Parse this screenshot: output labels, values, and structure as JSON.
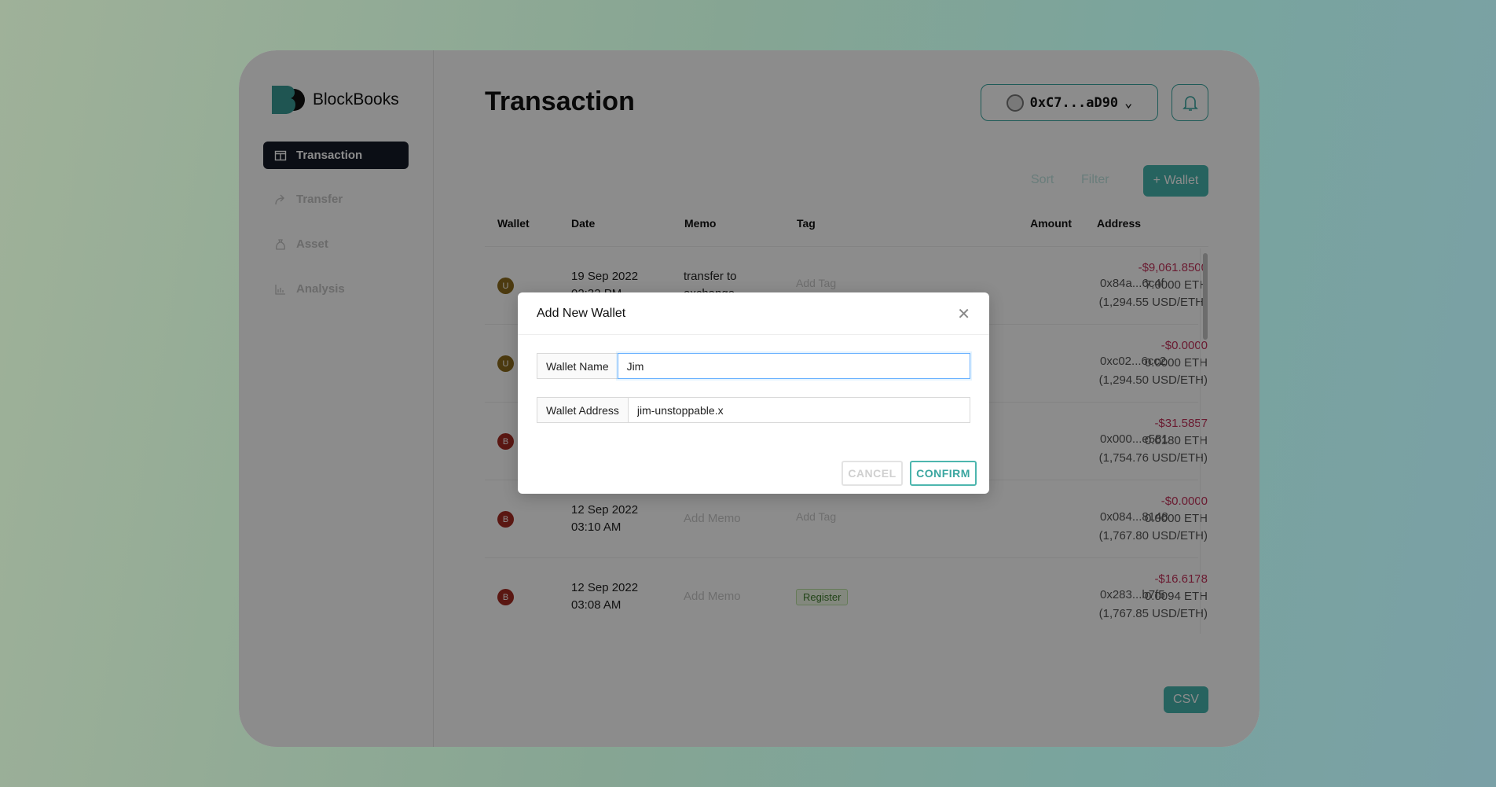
{
  "app": {
    "name": "BlockBooks",
    "accent": "#45b4ad"
  },
  "sidebar": {
    "items": [
      {
        "label": "Transaction",
        "icon": "table-icon",
        "active": true
      },
      {
        "label": "Transfer",
        "icon": "share-arrow-icon"
      },
      {
        "label": "Asset",
        "icon": "money-bag-icon"
      },
      {
        "label": "Analysis",
        "icon": "bar-chart-icon"
      }
    ]
  },
  "header": {
    "title": "Transaction",
    "wallet": "0xC7...aD90"
  },
  "toolbar": {
    "sort": "Sort",
    "filter": "Filter",
    "add_wallet": "+ Wallet",
    "csv": "CSV"
  },
  "table": {
    "columns": [
      "Wallet",
      "Date",
      "Memo",
      "Tag",
      "Amount",
      "Address"
    ],
    "rows": [
      {
        "wallet": "U",
        "color": "#8a6a1c",
        "date": "19 Sep 2022",
        "time": "02:32 PM",
        "memo": "transfer to",
        "memo2": "exchange",
        "tag": "Add Tag",
        "usd": "-$9,061.8500",
        "eth": "7.0000 ETH",
        "rate": "(1,294.55 USD/ETH)",
        "address": "0x84a...6c4f"
      },
      {
        "wallet": "U",
        "color": "#8a6a1c",
        "date": "",
        "time": "",
        "memo": "",
        "memo2": "",
        "tag": "",
        "usd": "-$0.0000",
        "eth": "0.0000 ETH",
        "rate": "(1,294.50 USD/ETH)",
        "address": "0xc02...6cc2"
      },
      {
        "wallet": "B",
        "color": "#a52a22",
        "date": "",
        "time": "",
        "memo": "",
        "memo2": "",
        "tag": "",
        "usd": "-$31.5857",
        "eth": "0.0180 ETH",
        "rate": "(1,754.76 USD/ETH)",
        "address": "0x000...e581"
      },
      {
        "wallet": "B",
        "color": "#a52a22",
        "date": "12 Sep 2022",
        "time": "03:10 AM",
        "memo": "Add Memo",
        "memo2": "",
        "tag": "Add Tag",
        "usd": "-$0.0000",
        "eth": "0.0000 ETH",
        "rate": "(1,767.80 USD/ETH)",
        "address": "0x084...8148"
      },
      {
        "wallet": "B",
        "color": "#a52a22",
        "date": "12 Sep 2022",
        "time": "03:08 AM",
        "memo": "Add Memo",
        "memo2": "",
        "tag": "Register",
        "usd": "-$16.6178",
        "eth": "0.0094 ETH",
        "rate": "(1,767.85 USD/ETH)",
        "address": "0x283...b7f5"
      }
    ]
  },
  "modal": {
    "title": "Add New Wallet",
    "name_label": "Wallet Name",
    "name_value": "Jim",
    "address_label": "Wallet Address",
    "address_value": "jim-unstoppable.x",
    "cancel": "CANCEL",
    "confirm": "CONFIRM"
  }
}
